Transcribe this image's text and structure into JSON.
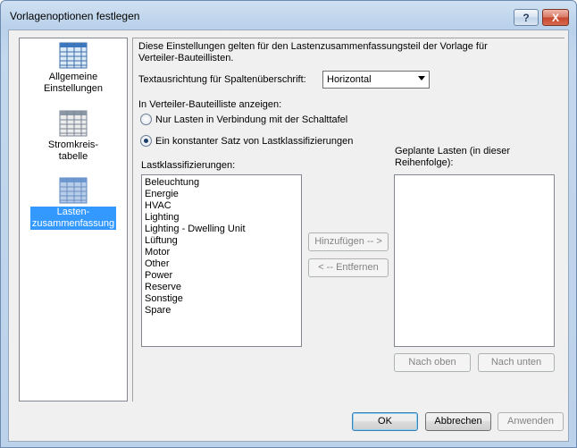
{
  "window": {
    "title": "Vorlagenoptionen festlegen"
  },
  "titlebar_buttons": {
    "help": "?",
    "close": "X"
  },
  "nav": {
    "items": [
      {
        "label_1": "Allgemeine",
        "label_2": "Einstellungen",
        "icon": "table-grid-icon"
      },
      {
        "label_1": "Stromkreis-",
        "label_2": "tabelle",
        "icon": "table-grid-icon"
      },
      {
        "label_1": "Lasten-",
        "label_2": "zusammenfassung",
        "icon": "table-grid-icon"
      }
    ]
  },
  "description": {
    "line1": "Diese Einstellungen gelten für den Lastenzusammenfassungsteil der Vorlage für",
    "line2": "Verteiler-Bauteillisten."
  },
  "text_orientation": {
    "label": "Textausrichtung für Spaltenüberschrift:",
    "value": "Horizontal"
  },
  "show_in_list": {
    "label": "In Verteiler-Bauteilliste anzeigen:",
    "option1": "Nur Lasten in Verbindung mit der Schalttafel",
    "option2": "Ein konstanter Satz von Lastklassifizierungen"
  },
  "load_classifications": {
    "label": "Lastklassifizierungen:",
    "items": [
      "Beleuchtung",
      "Energie",
      "HVAC",
      "Lighting",
      "Lighting - Dwelling Unit",
      "Lüftung",
      "Motor",
      "Other",
      "Power",
      "Reserve",
      "Sonstige",
      "Spare"
    ]
  },
  "planned_loads": {
    "label_1": "Geplante Lasten (in dieser",
    "label_2": "Reihenfolge):"
  },
  "buttons": {
    "add": "Hinzufügen -- >",
    "remove": "< -- Entfernen",
    "move_up": "Nach oben",
    "move_down": "Nach unten",
    "ok": "OK",
    "cancel": "Abbrechen",
    "apply": "Anwenden"
  }
}
